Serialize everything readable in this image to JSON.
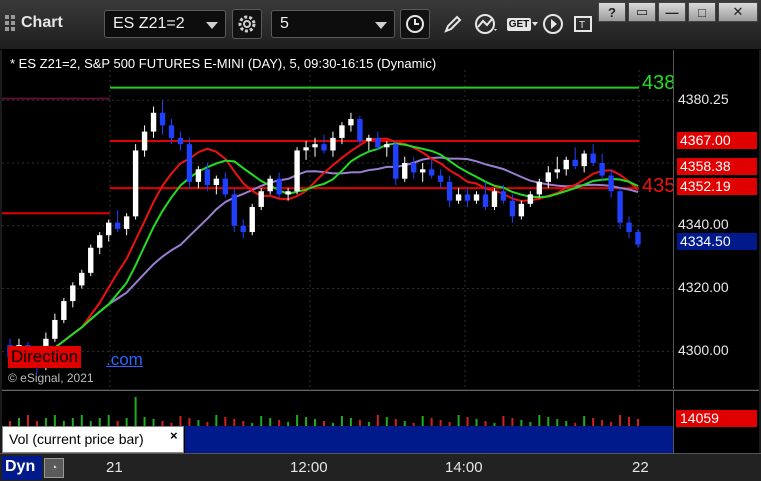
{
  "toolbar": {
    "app_title": "Chart",
    "symbol_value": "ES Z21=2",
    "interval_value": "5",
    "get_label": "GET"
  },
  "window_buttons": {
    "help": "?",
    "restore": "▭",
    "minimize": "—",
    "maximize": "□",
    "close": "✕"
  },
  "chart": {
    "title": "* ES Z21=2, S&P 500 FUTURES E-MINI (DAY), 5, 09:30-16:15 (Dynamic)",
    "copyright": "© eSignal, 2021",
    "watermark_text": "Direction",
    "watermark_link": ".com",
    "green_line_label": "438",
    "red_line_label": "435",
    "colors": {
      "up_candle": "#ffffff",
      "down_candle": "#2040ff",
      "level_red": "#e00000",
      "level_green": "#22cc22",
      "ma_green": "#22dd22",
      "ma_red": "#ee1111",
      "ma_purple": "#9a7fd0",
      "price_tag_blue": "#001a8c"
    }
  },
  "price_axis": {
    "ticks": [
      "4380.25",
      "4367.00",
      "4358.38",
      "4352.19",
      "4340.00",
      "4334.50",
      "4320.00",
      "4300.00"
    ],
    "tag_4380": "4380.25",
    "tag_4367": "4367.00",
    "tag_4358": "4358.38",
    "tag_4352": "4352.19",
    "label_4340": "4340.00",
    "tag_last": "4334.50",
    "label_4320": "4320.00",
    "label_4300": "4300.00"
  },
  "volume": {
    "label": "Vol (current price bar)",
    "close": "×",
    "value": "14059"
  },
  "time_axis": {
    "dyn_label": "Dyn",
    "labels": [
      "21",
      "12:00",
      "14:00",
      "22"
    ]
  },
  "chart_data": {
    "type": "candlestick",
    "ylim": [
      4288,
      4396
    ],
    "levels": [
      {
        "name": "green level",
        "value": 4384
      },
      {
        "name": "red level upper",
        "value": 4367
      },
      {
        "name": "red level lower",
        "value": 4352
      },
      {
        "name": "prior red level",
        "value": 4344
      },
      {
        "name": "prior purple level",
        "value": 4379
      }
    ],
    "candles": [
      [
        4302,
        4304,
        4296,
        4298
      ],
      [
        4298,
        4304,
        4297,
        4302
      ],
      [
        4302,
        4303,
        4296,
        4297
      ],
      [
        4297,
        4300,
        4293,
        4296
      ],
      [
        4296,
        4306,
        4294,
        4304
      ],
      [
        4304,
        4312,
        4303,
        4310
      ],
      [
        4310,
        4317,
        4309,
        4316
      ],
      [
        4316,
        4322,
        4314,
        4321
      ],
      [
        4321,
        4326,
        4320,
        4325
      ],
      [
        4325,
        4334,
        4324,
        4333
      ],
      [
        4333,
        4338,
        4331,
        4337
      ],
      [
        4337,
        4342,
        4335,
        4341
      ],
      [
        4341,
        4345,
        4338,
        4339
      ],
      [
        4339,
        4344,
        4337,
        4343
      ],
      [
        4343,
        4366,
        4342,
        4364
      ],
      [
        4364,
        4372,
        4362,
        4370
      ],
      [
        4370,
        4378,
        4368,
        4376
      ],
      [
        4376,
        4380,
        4369,
        4372
      ],
      [
        4372,
        4374,
        4366,
        4368
      ],
      [
        4368,
        4370,
        4364,
        4366
      ],
      [
        4366,
        4368,
        4352,
        4354
      ],
      [
        4354,
        4359,
        4352,
        4358
      ],
      [
        4358,
        4360,
        4351,
        4353
      ],
      [
        4353,
        4356,
        4350,
        4355
      ],
      [
        4355,
        4357,
        4349,
        4350
      ],
      [
        4350,
        4352,
        4338,
        4340
      ],
      [
        4340,
        4342,
        4336,
        4338
      ],
      [
        4338,
        4347,
        4337,
        4346
      ],
      [
        4346,
        4352,
        4345,
        4351
      ],
      [
        4351,
        4356,
        4350,
        4355
      ],
      [
        4355,
        4357,
        4349,
        4350
      ],
      [
        4350,
        4352,
        4348,
        4351
      ],
      [
        4351,
        4365,
        4350,
        4364
      ],
      [
        4364,
        4367,
        4361,
        4365
      ],
      [
        4365,
        4368,
        4362,
        4366
      ],
      [
        4366,
        4369,
        4363,
        4364
      ],
      [
        4364,
        4370,
        4362,
        4368
      ],
      [
        4368,
        4373,
        4366,
        4372
      ],
      [
        4372,
        4376,
        4370,
        4374
      ],
      [
        4374,
        4375,
        4366,
        4367
      ],
      [
        4367,
        4369,
        4364,
        4368
      ],
      [
        4368,
        4370,
        4364,
        4365
      ],
      [
        4365,
        4367,
        4362,
        4366
      ],
      [
        4366,
        4367,
        4353,
        4355
      ],
      [
        4355,
        4362,
        4354,
        4360
      ],
      [
        4360,
        4362,
        4355,
        4357
      ],
      [
        4357,
        4360,
        4354,
        4358
      ],
      [
        4358,
        4361,
        4355,
        4356
      ],
      [
        4356,
        4358,
        4352,
        4354
      ],
      [
        4354,
        4356,
        4346,
        4348
      ],
      [
        4348,
        4352,
        4347,
        4350
      ],
      [
        4350,
        4352,
        4346,
        4348
      ],
      [
        4348,
        4351,
        4347,
        4350
      ],
      [
        4350,
        4354,
        4345,
        4346
      ],
      [
        4346,
        4352,
        4345,
        4351
      ],
      [
        4351,
        4353,
        4347,
        4348
      ],
      [
        4348,
        4350,
        4341,
        4343
      ],
      [
        4343,
        4348,
        4342,
        4347
      ],
      [
        4347,
        4351,
        4346,
        4350
      ],
      [
        4350,
        4355,
        4349,
        4354
      ],
      [
        4354,
        4359,
        4352,
        4357
      ],
      [
        4357,
        4362,
        4355,
        4358
      ],
      [
        4358,
        4362,
        4356,
        4361
      ],
      [
        4361,
        4365,
        4358,
        4359
      ],
      [
        4359,
        4364,
        4357,
        4363
      ],
      [
        4363,
        4366,
        4359,
        4360
      ],
      [
        4360,
        4363,
        4354,
        4356
      ],
      [
        4356,
        4358,
        4349,
        4351
      ],
      [
        4351,
        4352,
        4339,
        4341
      ],
      [
        4341,
        4343,
        4336,
        4338
      ],
      [
        4338,
        4339,
        4333,
        4334
      ]
    ],
    "volume_note": "volume histogram shown in lower pane"
  }
}
